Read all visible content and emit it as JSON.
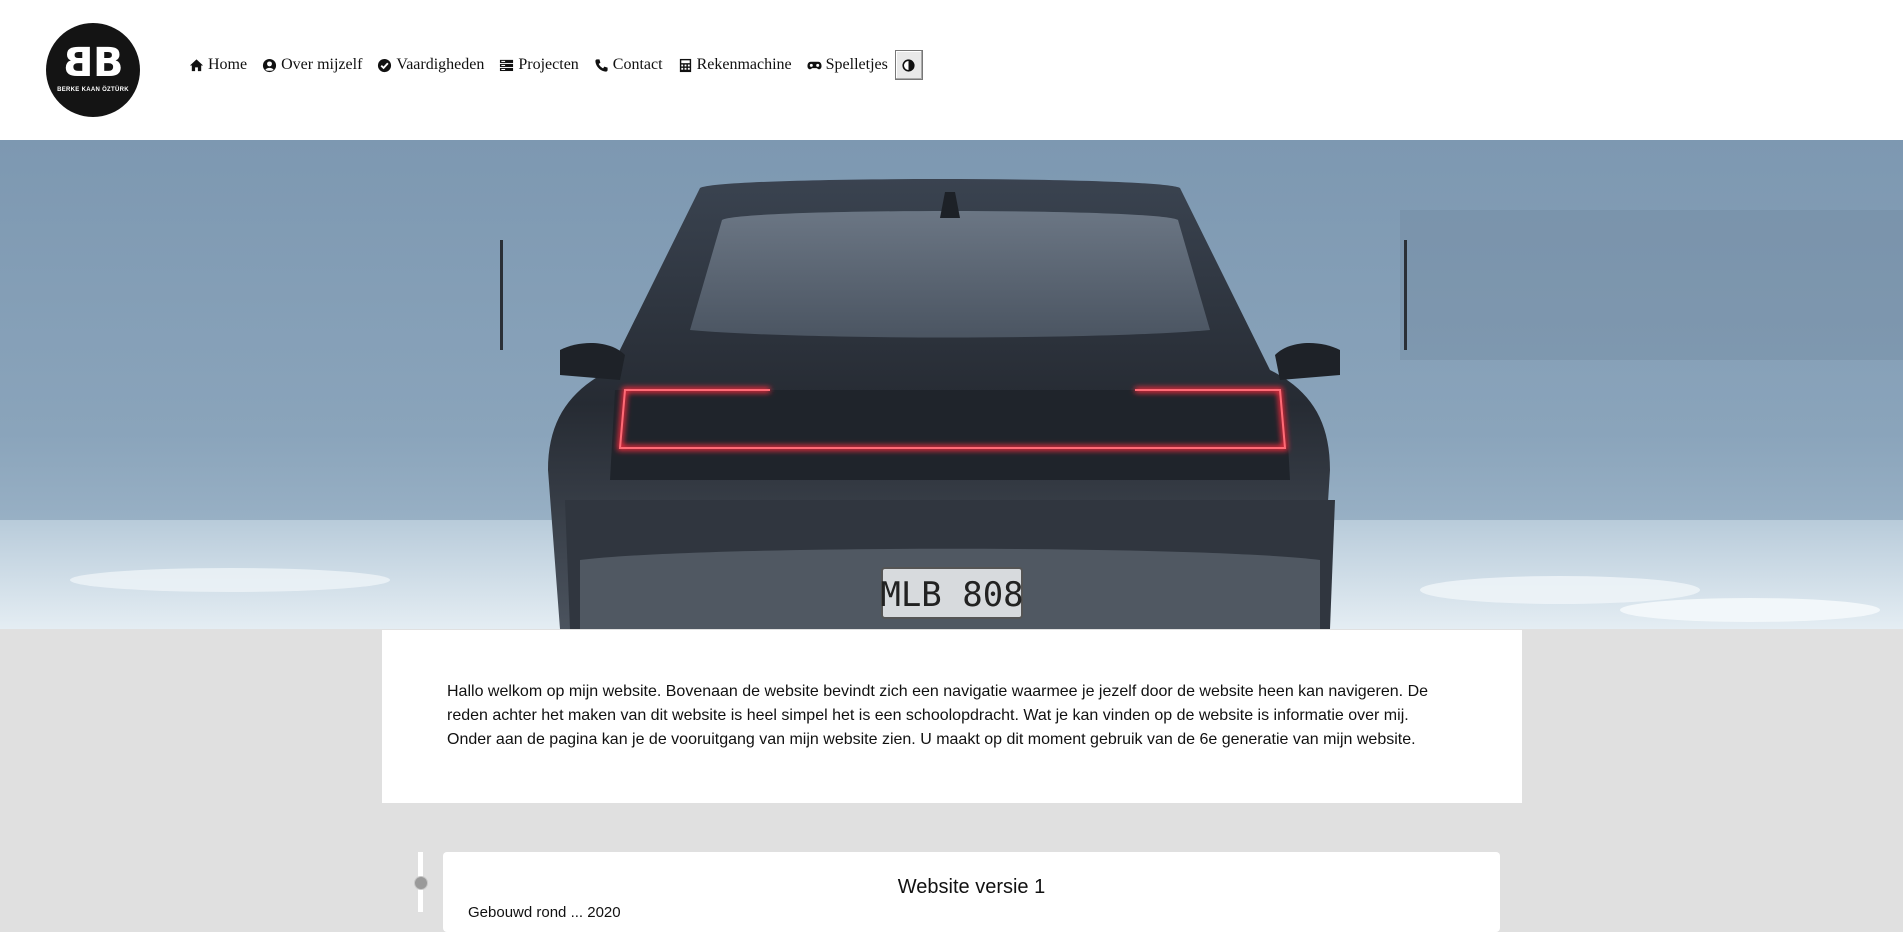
{
  "logo": {
    "mark": "BB",
    "name": "BERKE KAAN ÖZTÜRK"
  },
  "nav": {
    "items": [
      {
        "label": "Home",
        "icon": "home-icon"
      },
      {
        "label": "Over mijzelf",
        "icon": "user-circle-icon"
      },
      {
        "label": "Vaardigheden",
        "icon": "check-circle-icon"
      },
      {
        "label": "Projecten",
        "icon": "server-icon"
      },
      {
        "label": "Contact",
        "icon": "phone-icon"
      },
      {
        "label": "Rekenmachine",
        "icon": "calculator-icon"
      },
      {
        "label": "Spelletjes",
        "icon": "gamepad-icon"
      }
    ],
    "theme_toggle_icon": "contrast-icon"
  },
  "hero": {
    "plate": "MLB 808"
  },
  "intro": {
    "text": "Hallo welkom op mijn website. Bovenaan de website bevindt zich een navigatie waarmee je jezelf door de website heen kan navigeren. De reden achter het maken van dit website is heel simpel het is een schoolopdracht. Wat je kan vinden op de website is informatie over mij. Onder aan de pagina kan je de vooruitgang van mijn website zien. U maakt op dit moment gebruik van de 6e generatie van mijn website."
  },
  "timeline": {
    "items": [
      {
        "title": "Website versie 1",
        "date": "Gebouwd rond ... 2020"
      }
    ]
  },
  "colors": {
    "header_bg": "#ffffff",
    "page_bg": "#e0e0e0",
    "logo_bg": "#141414",
    "taillight": "#ff2a3c"
  }
}
